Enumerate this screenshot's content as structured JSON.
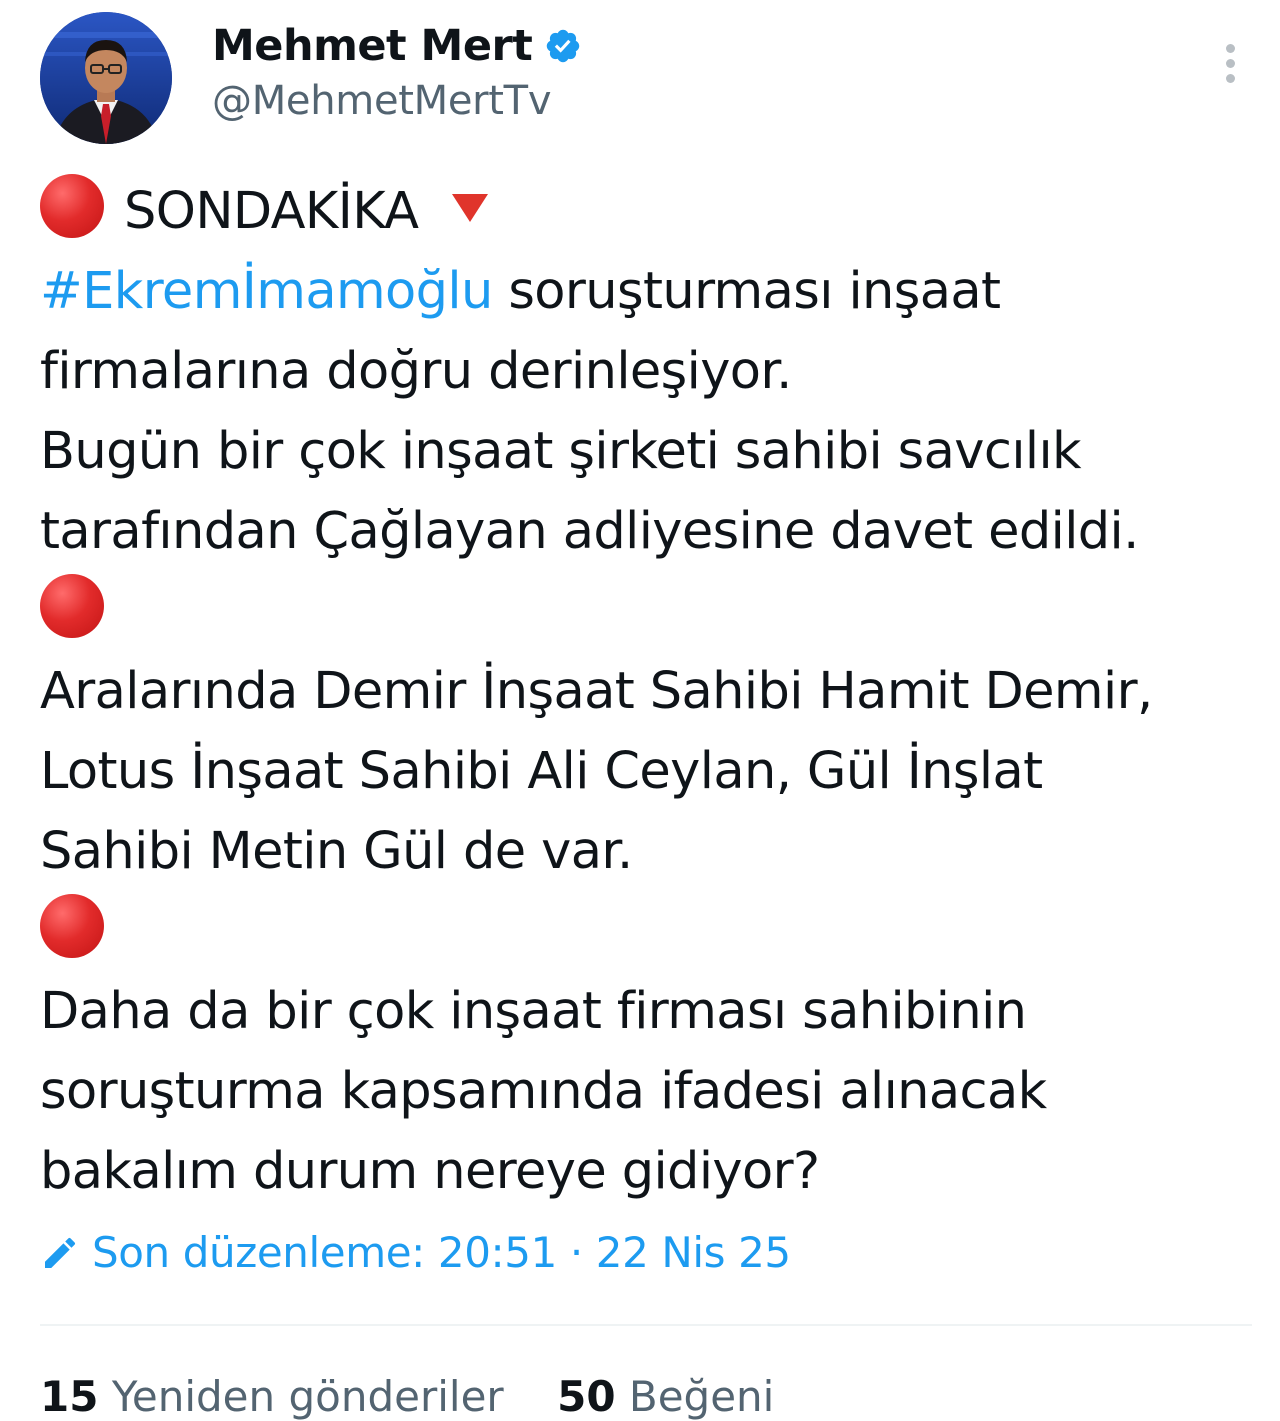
{
  "author": {
    "display_name": "Mehmet Mert",
    "handle": "@MehmetMertTv",
    "verified": true
  },
  "tweet": {
    "label": "SONDAKİKA",
    "hashtag": "#Ekremİmamoğlu",
    "lines": [
      " soruşturması inşaat",
      "firmalarına doğru derinleşiyor.",
      "Bugün bir çok inşaat şirketi sahibi savcılık",
      "tarafından Çağlayan adliyesine davet edildi.",
      "Aralarında Demir İnşaat Sahibi Hamit Demir,",
      "Lotus İnşaat Sahibi Ali Ceylan, Gül İnşlat",
      "Sahibi Metin Gül de var.",
      "Daha da bir çok inşaat firması sahibinin",
      "soruşturma kapsamında ifadesi alınacak",
      "bakalım durum nereye gidiyor?"
    ]
  },
  "edited": {
    "text": "Son düzenleme: 20:51 · 22 Nis 25"
  },
  "stats": {
    "reposts_count": "15",
    "reposts_label": "Yeniden gönderiler",
    "likes_count": "50",
    "likes_label": "Beğeni"
  },
  "icons": {
    "verified": "verified-badge-icon",
    "more": "more-vertical-icon",
    "edit": "pencil-icon",
    "bullet": "red-circle-emoji",
    "down": "red-triangle-down-emoji"
  },
  "colors": {
    "accent": "#1d9bf0",
    "text": "#0f1419",
    "muted": "#536471",
    "red": "#e22b2b"
  }
}
